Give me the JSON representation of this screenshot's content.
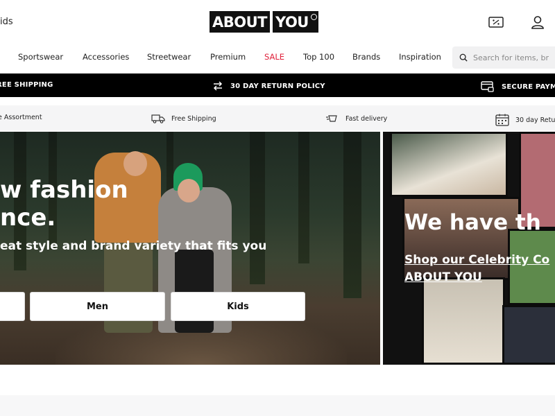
{
  "header": {
    "kids_tab": "ids",
    "logo_about": "ABOUT",
    "logo_you": "YOU",
    "icons": [
      "discount-icon",
      "user-icon"
    ]
  },
  "nav": {
    "items": [
      "Sportswear",
      "Accessories",
      "Streetwear",
      "Premium",
      "SALE",
      "Top 100",
      "Brands",
      "Inspiration"
    ],
    "search_placeholder": "Search for items, br"
  },
  "promo_bar": {
    "items": [
      "FREE SHIPPING",
      "30 DAY RETURN POLICY",
      "SECURE PAYM"
    ]
  },
  "usp_bar": {
    "items": [
      "e Assortment",
      "Free Shipping",
      "Fast delivery",
      "30 day Retu"
    ]
  },
  "hero": {
    "title_line1": "w fashion",
    "title_line2": "nce.",
    "subtitle": "eat style and brand variety that fits you",
    "buttons": [
      "",
      "Men",
      "Kids"
    ]
  },
  "celebrity": {
    "title": "We have th",
    "link_line1": "Shop our Celebrity Co",
    "link_line2": "ABOUT YOU"
  },
  "colors": {
    "sale": "#e0203a",
    "promo_bg": "#000000",
    "usp_bg": "#f5f5f6"
  }
}
